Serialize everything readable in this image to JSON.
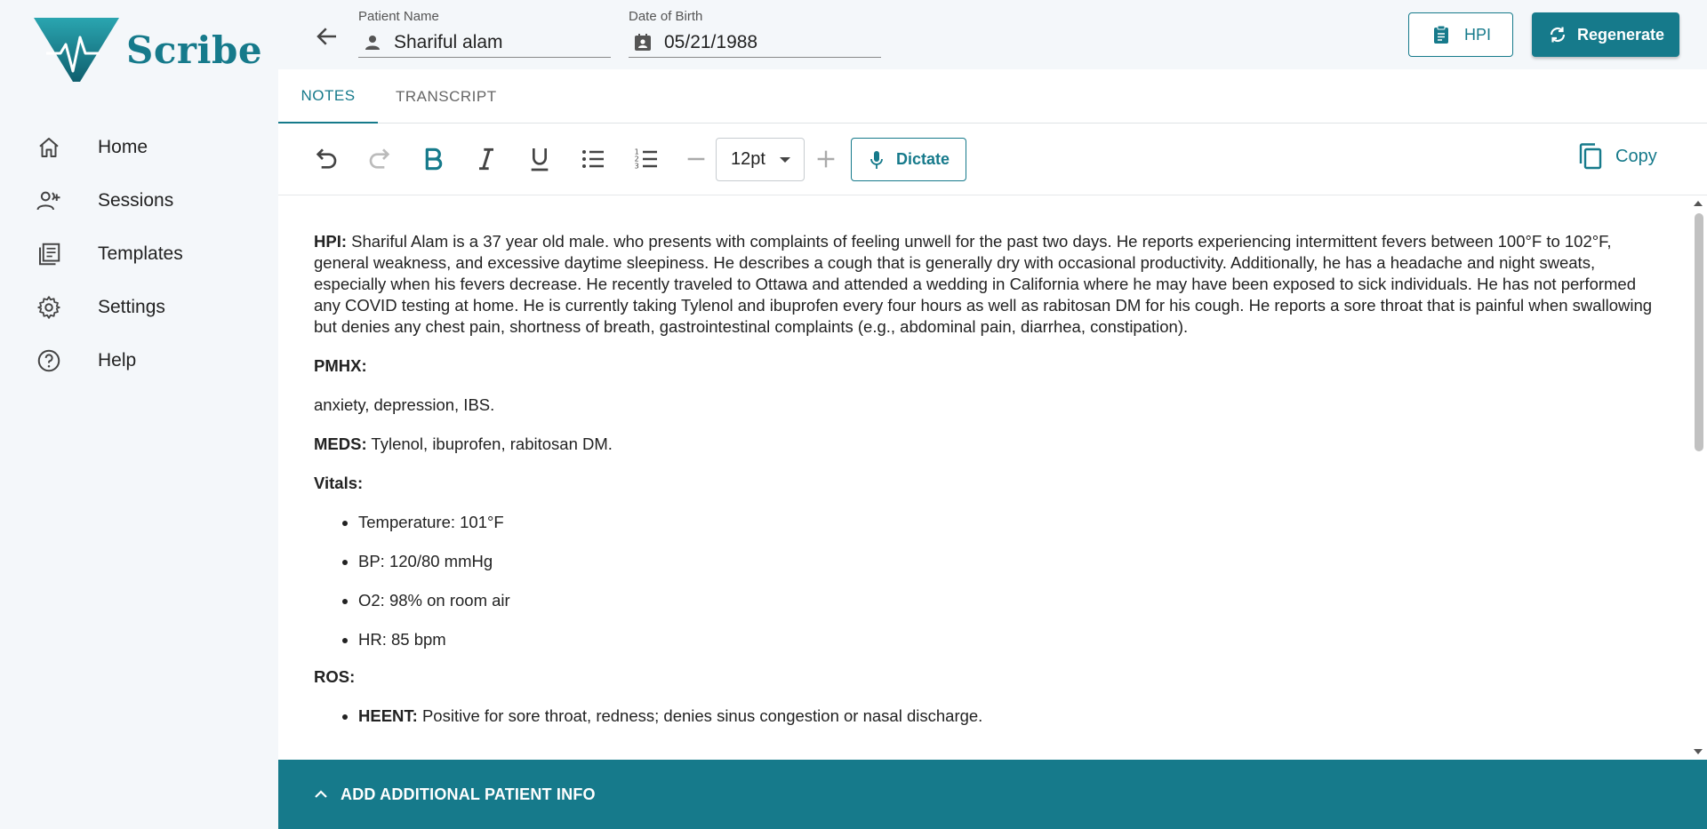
{
  "app": {
    "name": "Scribe",
    "brand_color": "#167a8b"
  },
  "nav": {
    "items": [
      {
        "label": "Home",
        "icon": "home-icon"
      },
      {
        "label": "Sessions",
        "icon": "users-add-icon"
      },
      {
        "label": "Templates",
        "icon": "templates-icon"
      },
      {
        "label": "Settings",
        "icon": "gear-icon"
      },
      {
        "label": "Help",
        "icon": "help-icon"
      }
    ]
  },
  "header": {
    "patient_name_label": "Patient Name",
    "patient_name_value": "Shariful alam",
    "dob_label": "Date of Birth",
    "dob_value": "05/21/1988",
    "hpi_button": "HPI",
    "regenerate_button": "Regenerate"
  },
  "tabs": [
    {
      "label": "NOTES",
      "active": true
    },
    {
      "label": "TRANSCRIPT",
      "active": false
    }
  ],
  "toolbar": {
    "font_size": "12pt",
    "dictate_label": "Dictate",
    "copy_label": "Copy"
  },
  "note": {
    "hpi_label": "HPI:",
    "hpi_text": " Shariful Alam is a 37 year old male. who presents with complaints of feeling unwell for the past two days. He reports experiencing intermittent fevers between 100°F to 102°F, general weakness, and excessive daytime sleepiness. He describes a cough that is generally dry with occasional productivity. Additionally, he has a headache and night sweats, especially when his fevers decrease. He recently traveled to Ottawa and attended a wedding in California where he may have been exposed to sick individuals. He has not performed any COVID testing at home. He is currently taking Tylenol and ibuprofen every four hours as well as rabitosan DM for his cough. He reports a sore throat that is painful when swallowing but denies any chest pain, shortness of breath, gastrointestinal complaints (e.g., abdominal pain, diarrhea, constipation).",
    "pmhx_label": "PMHX:",
    "pmhx_text": "anxiety, depression, IBS.",
    "meds_label": "MEDS:",
    "meds_text": " Tylenol, ibuprofen, rabitosan DM.",
    "vitals_label": "Vitals:",
    "vitals": [
      "Temperature: 101°F",
      "BP: 120/80 mmHg",
      "O2: 98% on room air",
      "HR: 85 bpm"
    ],
    "ros_label": "ROS:",
    "ros_heent_label": "HEENT:",
    "ros_heent_text": " Positive for sore throat, redness; denies sinus congestion or nasal discharge."
  },
  "bottom_bar": {
    "label": "ADD ADDITIONAL PATIENT INFO"
  }
}
